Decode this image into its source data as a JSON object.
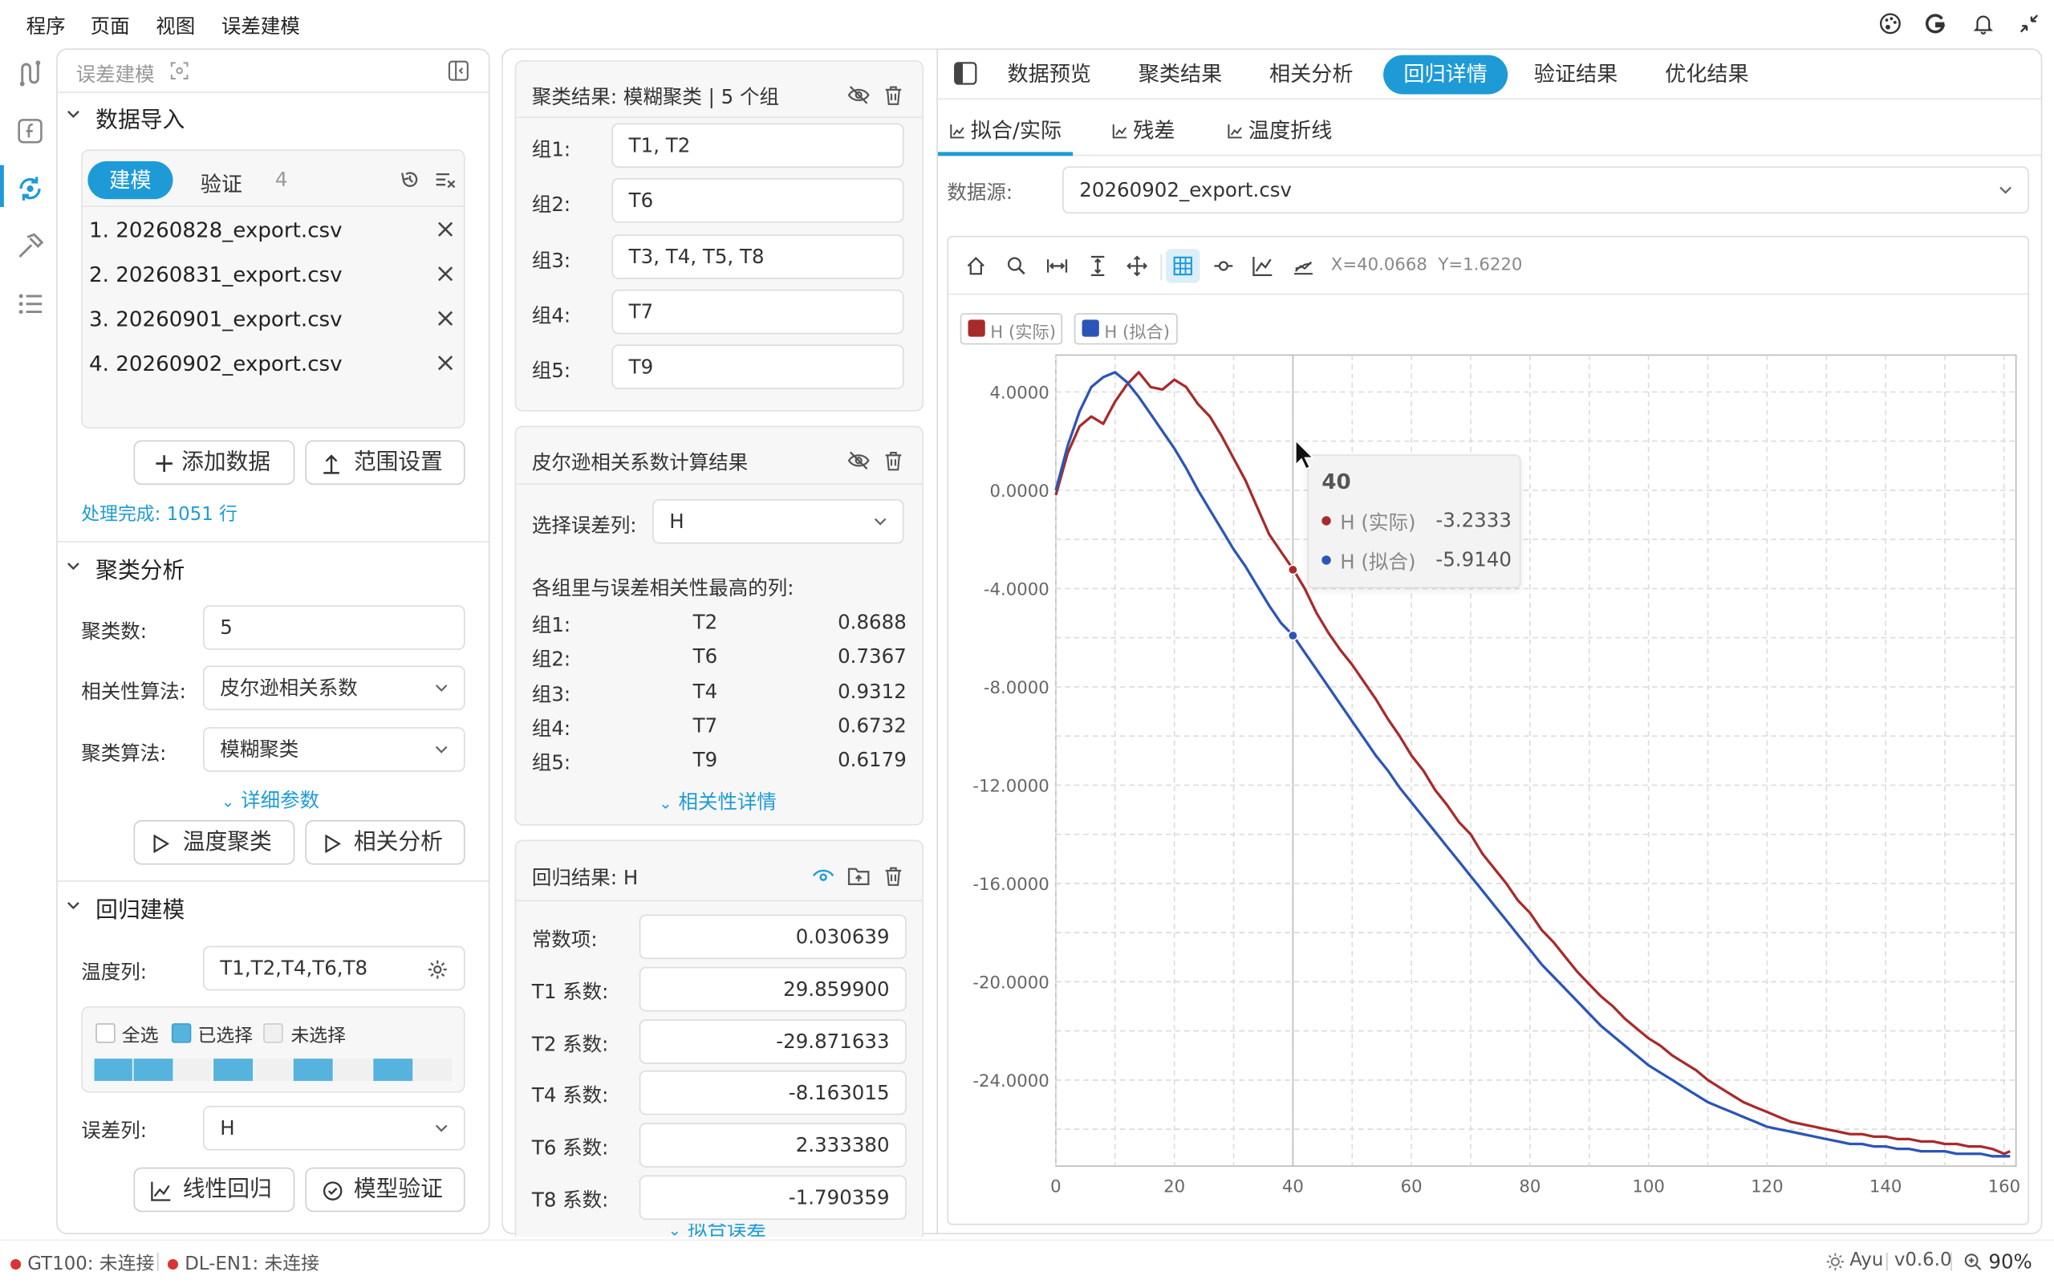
{
  "menu": {
    "items": [
      "程序",
      "页面",
      "视图",
      "误差建模"
    ]
  },
  "left_panel": {
    "title": "误差建模",
    "data_import": {
      "heading": "数据导入",
      "tab_model": "建模",
      "tab_verify": "验证",
      "count": "4",
      "files": [
        "1. 20260828_export.csv",
        "2. 20260831_export.csv",
        "3. 20260901_export.csv",
        "4. 20260902_export.csv"
      ],
      "add_button": "添加数据",
      "range_button": "范围设置",
      "status": "处理完成: 1051 行"
    },
    "cluster": {
      "heading": "聚类分析",
      "num_label": "聚类数:",
      "num_value": "5",
      "corr_label": "相关性算法:",
      "corr_value": "皮尔逊相关系数",
      "algo_label": "聚类算法:",
      "algo_value": "模糊聚类",
      "detail_link": "详细参数",
      "temp_cluster_button": "温度聚类",
      "corr_button": "相关分析"
    },
    "regression": {
      "heading": "回归建模",
      "temp_label": "温度列:",
      "temp_value": "T1,T2,T4,T6,T8",
      "legend_all": "全选",
      "legend_selected": "已选择",
      "legend_unselected": "未选择",
      "selected_cells": [
        1,
        1,
        0,
        1,
        0,
        1,
        0,
        1,
        0
      ],
      "error_label": "误差列:",
      "error_value": "H",
      "linear_button": "线性回归",
      "validate_button": "模型验证"
    }
  },
  "middle": {
    "cluster_result": {
      "title": "聚类结果: 模糊聚类 | 5 个组",
      "groups": [
        {
          "label": "组1:",
          "value": "T1, T2"
        },
        {
          "label": "组2:",
          "value": "T6"
        },
        {
          "label": "组3:",
          "value": "T3, T4, T5, T8"
        },
        {
          "label": "组4:",
          "value": "T7"
        },
        {
          "label": "组5:",
          "value": "T9"
        }
      ]
    },
    "pearson": {
      "title": "皮尔逊相关系数计算结果",
      "select_label": "选择误差列:",
      "select_value": "H",
      "subtitle": "各组里与误差相关性最高的列:",
      "rows": [
        {
          "group": "组1:",
          "col": "T2",
          "val": "0.8688"
        },
        {
          "group": "组2:",
          "col": "T6",
          "val": "0.7367"
        },
        {
          "group": "组3:",
          "col": "T4",
          "val": "0.9312"
        },
        {
          "group": "组4:",
          "col": "T7",
          "val": "0.6732"
        },
        {
          "group": "组5:",
          "col": "T9",
          "val": "0.6179"
        }
      ],
      "detail_link": "相关性详情"
    },
    "regression": {
      "title": "回归结果: H",
      "rows": [
        {
          "label": "常数项:",
          "value": "0.030639"
        },
        {
          "label": "T1 系数:",
          "value": "29.859900"
        },
        {
          "label": "T2 系数:",
          "value": "-29.871633"
        },
        {
          "label": "T4 系数:",
          "value": "-8.163015"
        },
        {
          "label": "T6 系数:",
          "value": "2.333380"
        },
        {
          "label": "T8 系数:",
          "value": "-1.790359"
        }
      ],
      "more_link": "拟合误差"
    }
  },
  "right": {
    "tabs": [
      "数据预览",
      "聚类结果",
      "相关分析",
      "回归详情",
      "验证结果",
      "优化结果"
    ],
    "active_tab": 3,
    "subtabs": [
      "拟合/实际",
      "残差",
      "温度折线"
    ],
    "active_subtab": 0,
    "source_label": "数据源:",
    "source_value": "20260902_export.csv",
    "coords": "X=40.0668  Y=1.6220",
    "tooltip": {
      "x": "40",
      "rows": [
        {
          "name": "H (实际)",
          "value": "-3.2333"
        },
        {
          "name": "H (拟合)",
          "value": "-5.9140"
        }
      ]
    }
  },
  "status": {
    "gt": "GT100: 未连接",
    "dl": "DL-EN1: 未连接",
    "theme": "Ayu",
    "version": "v0.6.0",
    "zoom": "90%"
  },
  "colors": {
    "accent": "#1e9bd7",
    "actual": "#a82b2b",
    "fit": "#2b55b8"
  },
  "chart_data": {
    "type": "line",
    "xlim": [
      0,
      162
    ],
    "ylim": [
      -27.5,
      5.5
    ],
    "x_ticks": [
      0,
      20,
      40,
      60,
      80,
      100,
      120,
      140,
      160
    ],
    "y_ticks": [
      4,
      0,
      -4,
      -8,
      -12,
      -16,
      -20,
      -24
    ],
    "y_tick_labels": [
      "4.0000",
      "0.0000",
      "-4.0000",
      "-8.0000",
      "-12.0000",
      "-16.0000",
      "-20.0000",
      "-24.0000"
    ],
    "grid": true,
    "legend": "top-left",
    "series": [
      {
        "name": "H (实际)",
        "color": "#a82b2b",
        "points": [
          [
            0,
            -0.2
          ],
          [
            2,
            1.5
          ],
          [
            4,
            2.6
          ],
          [
            6,
            3.0
          ],
          [
            8,
            2.7
          ],
          [
            10,
            3.6
          ],
          [
            12,
            4.3
          ],
          [
            14,
            4.8
          ],
          [
            16,
            4.2
          ],
          [
            18,
            4.1
          ],
          [
            20,
            4.5
          ],
          [
            22,
            4.2
          ],
          [
            24,
            3.5
          ],
          [
            26,
            3.0
          ],
          [
            28,
            2.2
          ],
          [
            30,
            1.3
          ],
          [
            32,
            0.4
          ],
          [
            34,
            -0.7
          ],
          [
            36,
            -1.8
          ],
          [
            38,
            -2.5
          ],
          [
            40,
            -3.2
          ],
          [
            42,
            -4.0
          ],
          [
            44,
            -5.0
          ],
          [
            46,
            -5.8
          ],
          [
            48,
            -6.5
          ],
          [
            50,
            -7.1
          ],
          [
            52,
            -7.8
          ],
          [
            54,
            -8.5
          ],
          [
            56,
            -9.3
          ],
          [
            58,
            -10.0
          ],
          [
            60,
            -10.8
          ],
          [
            62,
            -11.4
          ],
          [
            64,
            -12.2
          ],
          [
            66,
            -12.8
          ],
          [
            68,
            -13.5
          ],
          [
            70,
            -14.0
          ],
          [
            72,
            -14.8
          ],
          [
            74,
            -15.4
          ],
          [
            76,
            -16.0
          ],
          [
            78,
            -16.7
          ],
          [
            80,
            -17.2
          ],
          [
            82,
            -17.9
          ],
          [
            84,
            -18.4
          ],
          [
            86,
            -19.0
          ],
          [
            88,
            -19.6
          ],
          [
            90,
            -20.1
          ],
          [
            92,
            -20.6
          ],
          [
            94,
            -21.0
          ],
          [
            96,
            -21.5
          ],
          [
            98,
            -21.9
          ],
          [
            100,
            -22.3
          ],
          [
            102,
            -22.6
          ],
          [
            104,
            -23.0
          ],
          [
            106,
            -23.3
          ],
          [
            108,
            -23.6
          ],
          [
            110,
            -24.0
          ],
          [
            112,
            -24.3
          ],
          [
            114,
            -24.6
          ],
          [
            116,
            -24.9
          ],
          [
            118,
            -25.1
          ],
          [
            120,
            -25.3
          ],
          [
            122,
            -25.5
          ],
          [
            124,
            -25.7
          ],
          [
            126,
            -25.8
          ],
          [
            128,
            -25.9
          ],
          [
            130,
            -26.0
          ],
          [
            132,
            -26.1
          ],
          [
            134,
            -26.2
          ],
          [
            136,
            -26.2
          ],
          [
            138,
            -26.3
          ],
          [
            140,
            -26.3
          ],
          [
            142,
            -26.4
          ],
          [
            144,
            -26.4
          ],
          [
            146,
            -26.5
          ],
          [
            148,
            -26.5
          ],
          [
            150,
            -26.6
          ],
          [
            152,
            -26.6
          ],
          [
            154,
            -26.7
          ],
          [
            156,
            -26.7
          ],
          [
            158,
            -26.8
          ],
          [
            160,
            -27.0
          ],
          [
            161,
            -26.9
          ]
        ]
      },
      {
        "name": "H (拟合)",
        "color": "#2b55b8",
        "points": [
          [
            0,
            0.0
          ],
          [
            2,
            1.8
          ],
          [
            4,
            3.2
          ],
          [
            6,
            4.2
          ],
          [
            8,
            4.6
          ],
          [
            10,
            4.8
          ],
          [
            12,
            4.4
          ],
          [
            14,
            3.8
          ],
          [
            16,
            3.1
          ],
          [
            18,
            2.4
          ],
          [
            20,
            1.7
          ],
          [
            22,
            0.9
          ],
          [
            24,
            0.0
          ],
          [
            26,
            -0.8
          ],
          [
            28,
            -1.6
          ],
          [
            30,
            -2.4
          ],
          [
            32,
            -3.1
          ],
          [
            34,
            -3.9
          ],
          [
            36,
            -4.7
          ],
          [
            38,
            -5.4
          ],
          [
            40,
            -5.9
          ],
          [
            42,
            -6.6
          ],
          [
            44,
            -7.3
          ],
          [
            46,
            -8.0
          ],
          [
            48,
            -8.7
          ],
          [
            50,
            -9.4
          ],
          [
            52,
            -10.1
          ],
          [
            54,
            -10.8
          ],
          [
            56,
            -11.4
          ],
          [
            58,
            -12.1
          ],
          [
            60,
            -12.7
          ],
          [
            62,
            -13.3
          ],
          [
            64,
            -13.9
          ],
          [
            66,
            -14.5
          ],
          [
            68,
            -15.1
          ],
          [
            70,
            -15.7
          ],
          [
            72,
            -16.3
          ],
          [
            74,
            -16.9
          ],
          [
            76,
            -17.5
          ],
          [
            78,
            -18.1
          ],
          [
            80,
            -18.7
          ],
          [
            82,
            -19.3
          ],
          [
            84,
            -19.8
          ],
          [
            86,
            -20.3
          ],
          [
            88,
            -20.8
          ],
          [
            90,
            -21.3
          ],
          [
            92,
            -21.8
          ],
          [
            94,
            -22.2
          ],
          [
            96,
            -22.6
          ],
          [
            98,
            -23.0
          ],
          [
            100,
            -23.4
          ],
          [
            102,
            -23.7
          ],
          [
            104,
            -24.0
          ],
          [
            106,
            -24.3
          ],
          [
            108,
            -24.6
          ],
          [
            110,
            -24.9
          ],
          [
            112,
            -25.1
          ],
          [
            114,
            -25.3
          ],
          [
            116,
            -25.5
          ],
          [
            118,
            -25.7
          ],
          [
            120,
            -25.9
          ],
          [
            122,
            -26.0
          ],
          [
            124,
            -26.1
          ],
          [
            126,
            -26.2
          ],
          [
            128,
            -26.3
          ],
          [
            130,
            -26.4
          ],
          [
            132,
            -26.5
          ],
          [
            134,
            -26.6
          ],
          [
            136,
            -26.6
          ],
          [
            138,
            -26.7
          ],
          [
            140,
            -26.7
          ],
          [
            142,
            -26.8
          ],
          [
            144,
            -26.8
          ],
          [
            146,
            -26.9
          ],
          [
            148,
            -26.9
          ],
          [
            150,
            -26.9
          ],
          [
            152,
            -27.0
          ],
          [
            154,
            -27.0
          ],
          [
            156,
            -27.0
          ],
          [
            158,
            -27.1
          ],
          [
            160,
            -27.1
          ],
          [
            161,
            -27.1
          ]
        ]
      }
    ],
    "highlight": [
      {
        "series": "H (实际)",
        "x": 40,
        "y": -3.2333
      },
      {
        "series": "H (拟合)",
        "x": 40,
        "y": -5.914
      }
    ]
  }
}
